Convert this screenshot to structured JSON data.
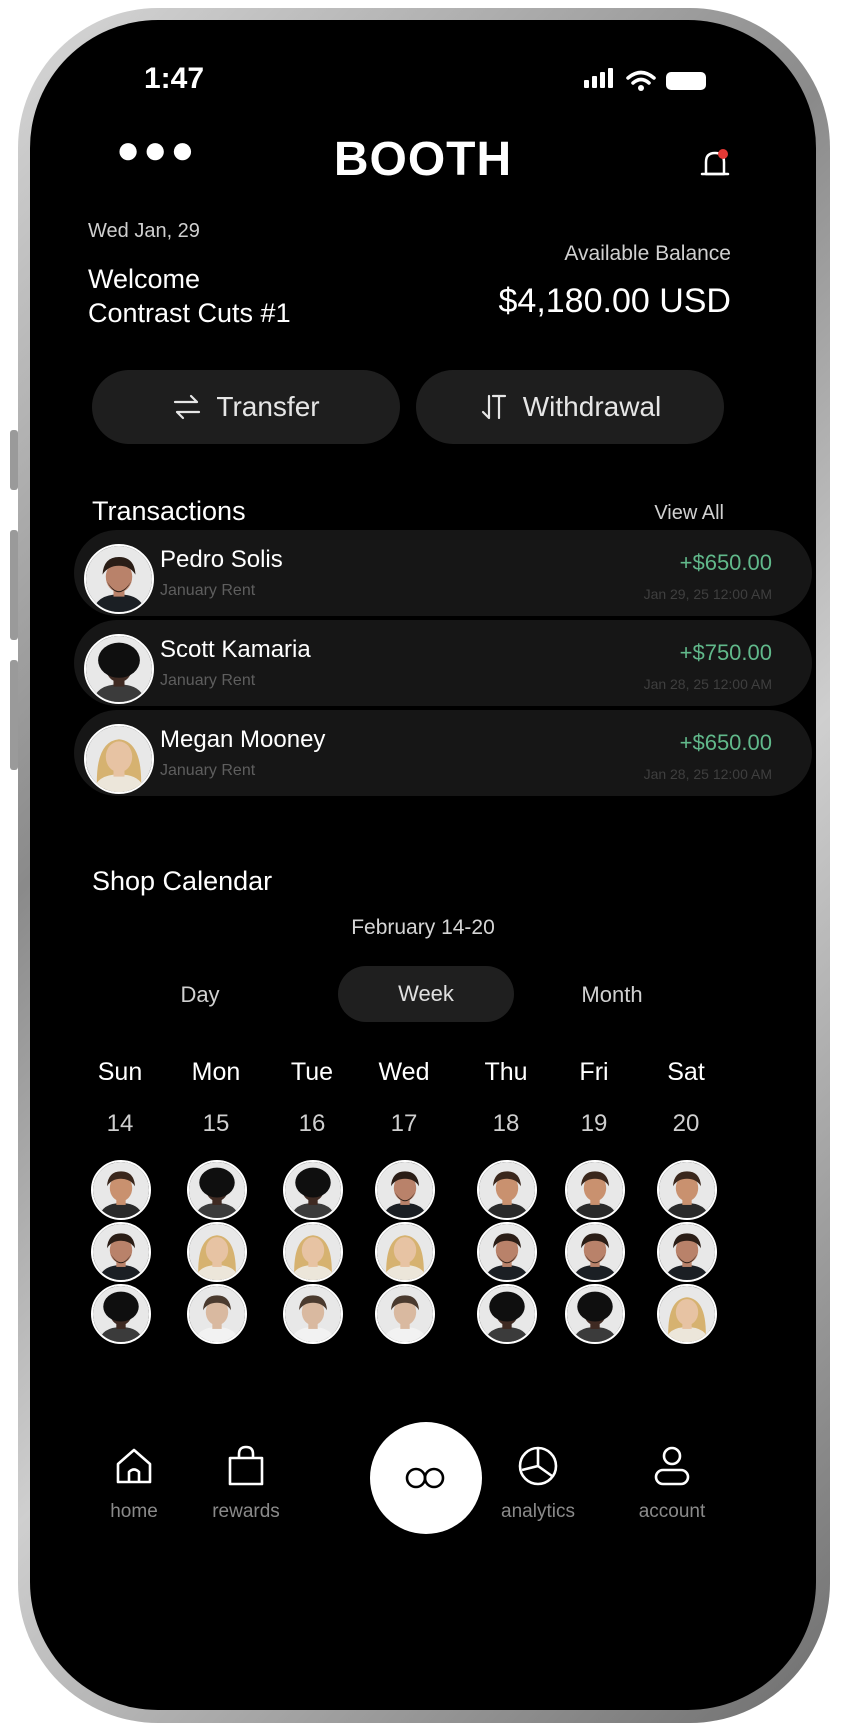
{
  "status_bar": {
    "time": "1:47"
  },
  "header": {
    "title": "BOOTH",
    "menu_icon": "more-dots-icon",
    "notification_icon": "bell-icon"
  },
  "welcome": {
    "date": "Wed Jan, 29",
    "greeting": "Welcome",
    "shop_name": "Contrast Cuts #1"
  },
  "balance": {
    "label": "Available Balance",
    "value": "$4,180.00 USD"
  },
  "actions": {
    "transfer_label": "Transfer",
    "withdrawal_label": "Withdrawal"
  },
  "transactions": {
    "title": "Transactions",
    "view_all": "View All",
    "items": [
      {
        "name": "Pedro Solis",
        "memo": "January Rent",
        "amount": "+$650.00",
        "date": "Jan 29, 25 12:00 AM",
        "avatar": "pedro"
      },
      {
        "name": "Scott Kamaria",
        "memo": "January Rent",
        "amount": "+$750.00",
        "date": "Jan 28, 25 12:00 AM",
        "avatar": "scott"
      },
      {
        "name": "Megan Mooney",
        "memo": "January Rent",
        "amount": "+$650.00",
        "date": "Jan 28, 25 12:00 AM",
        "avatar": "megan"
      }
    ]
  },
  "calendar": {
    "title": "Shop Calendar",
    "range": "February 14-20",
    "views": [
      "Day",
      "Week",
      "Month"
    ],
    "active_view": "Week",
    "days": [
      {
        "dow": "Sun",
        "num": "14"
      },
      {
        "dow": "Mon",
        "num": "15"
      },
      {
        "dow": "Tue",
        "num": "16"
      },
      {
        "dow": "Wed",
        "num": "17"
      },
      {
        "dow": "Thu",
        "num": "18"
      },
      {
        "dow": "Fri",
        "num": "19"
      },
      {
        "dow": "Sat",
        "num": "20"
      }
    ],
    "schedule_rows": [
      [
        "pedro-alt",
        "scott",
        "scott",
        "pedro",
        "pedro-alt",
        "pedro-alt",
        "pedro-alt"
      ],
      [
        "pedro",
        "megan",
        "megan",
        "megan",
        "pedro",
        "pedro",
        "pedro"
      ],
      [
        "scott",
        "guy",
        "guy",
        "guy",
        "scott",
        "scott",
        "megan"
      ]
    ]
  },
  "bottom_nav": {
    "home": "home",
    "rewards": "rewards",
    "center_icon": "infinity-icon",
    "analytics": "analytics",
    "account": "account"
  },
  "colors": {
    "background": "#000000",
    "card": "#161616",
    "positive_amount": "#61b98b",
    "notification_dot": "#e53935"
  }
}
